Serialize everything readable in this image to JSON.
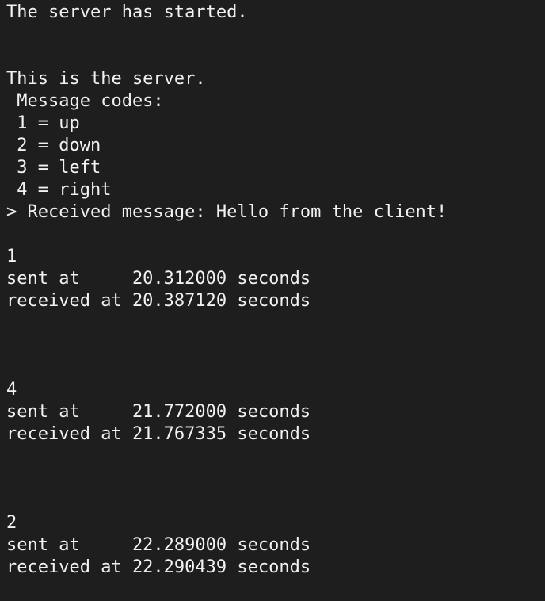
{
  "colors": {
    "background": "#1e1e1e",
    "text": "#f2f2f2"
  },
  "terminal": {
    "lines": [
      "The server has started.",
      "",
      "",
      "This is the server.",
      " Message codes:",
      " 1 = up",
      " 2 = down",
      " 3 = left",
      " 4 = right",
      "> Received message: Hello from the client!",
      "",
      "1",
      "sent at     20.312000 seconds",
      "received at 20.387120 seconds",
      "",
      "",
      "",
      "4",
      "sent at     21.772000 seconds",
      "received at 21.767335 seconds",
      "",
      "",
      "",
      "2",
      "sent at     22.289000 seconds",
      "received at 22.290439 seconds"
    ]
  }
}
